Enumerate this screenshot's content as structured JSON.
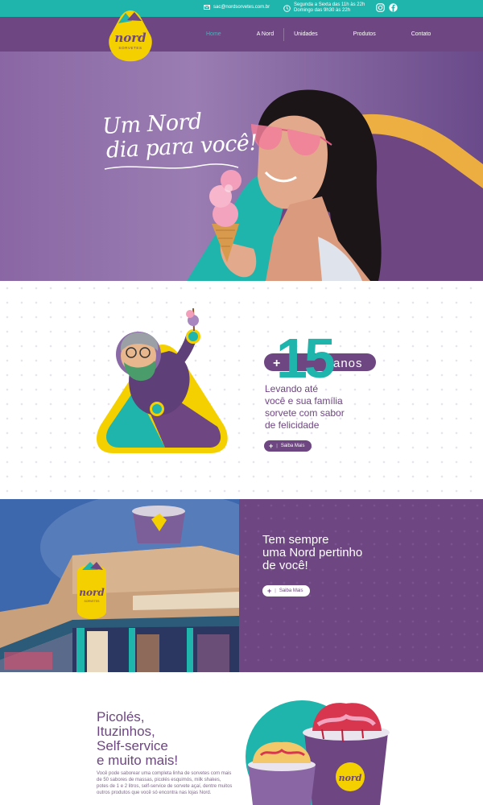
{
  "topbar": {
    "email": "sac@nordsorvetes.com.br",
    "hours_line1": "Segunda a Sexta das 11h às 22h",
    "hours_line2": "Domingo das 9h30 às 22h"
  },
  "logo": {
    "name": "nord",
    "tagline": "SORVETES"
  },
  "nav": {
    "items": [
      {
        "label": "Home"
      },
      {
        "label": "A Nord"
      },
      {
        "label": "Unidades"
      },
      {
        "label": "Produtos"
      },
      {
        "label": "Contato"
      }
    ]
  },
  "hero": {
    "title_line1": "Um Nord",
    "title_line2": "dia para você!"
  },
  "anniversary": {
    "plus": "+",
    "number": "15",
    "unit": "anos",
    "text_line1": "Levando até",
    "text_line2": "você e sua família",
    "text_line3": "sorvete com sabor",
    "text_line4": "de felicidade",
    "button_label": "Saiba Mais"
  },
  "stores": {
    "title_line1": "Tem sempre",
    "title_line2": "uma Nord pertinho",
    "title_line3": "de você!",
    "button_label": "Saiba Mais",
    "store_sign": "nord",
    "store_sign_sub": "SORVETES"
  },
  "products": {
    "title_line1": "Picolés,",
    "title_line2": "Ituzinhos,",
    "title_line3": "Self-service",
    "title_line4": "e muito mais!",
    "body": "Você pode saborear uma completa linha de sorvetes com mais de 50 sabores de massas, picolés esquimós, milk shakes, potes de 1 e 2 litros, self-service de sorvete açaí, dentre muitos outros produtos que você só encontra nas lojas Nord.",
    "cup_logo": "nord"
  },
  "colors": {
    "purple": "#6e4681",
    "teal": "#1fb5ac",
    "yellow": "#f5d000"
  }
}
